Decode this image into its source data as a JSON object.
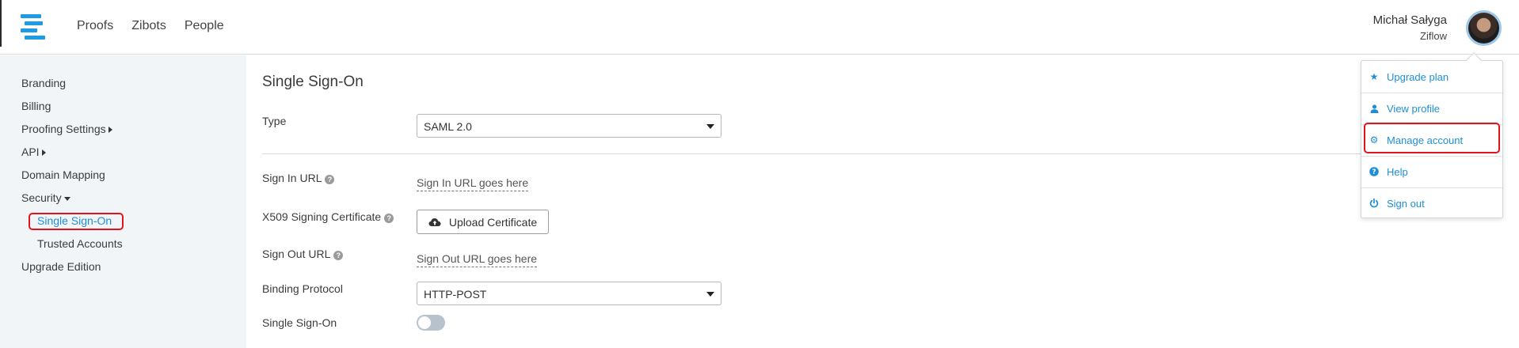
{
  "nav": {
    "items": [
      "Proofs",
      "Zibots",
      "People"
    ]
  },
  "user": {
    "name": "Michał Sałyga",
    "org": "Ziflow"
  },
  "sidebar": {
    "items": [
      {
        "label": "Branding"
      },
      {
        "label": "Billing"
      },
      {
        "label": "Proofing Settings"
      },
      {
        "label": "API"
      },
      {
        "label": "Domain Mapping"
      },
      {
        "label": "Security"
      },
      {
        "label": "Single Sign-On"
      },
      {
        "label": "Trusted Accounts"
      },
      {
        "label": "Upgrade Edition"
      }
    ]
  },
  "main": {
    "title": "Single Sign-On",
    "type_label": "Type",
    "type_value": "SAML 2.0",
    "sign_in_label": "Sign In URL",
    "sign_in_placeholder": "Sign In URL goes here",
    "cert_label": "X509 Signing Certificate",
    "upload_label": "Upload Certificate",
    "sign_out_label": "Sign Out URL",
    "sign_out_placeholder": "Sign Out URL goes here",
    "binding_label": "Binding Protocol",
    "binding_value": "HTTP-POST",
    "sso_toggle_label": "Single Sign-On",
    "sso_enabled": false
  },
  "menu": {
    "items": [
      {
        "label": "Upgrade plan",
        "icon": "star-icon"
      },
      {
        "label": "View profile",
        "icon": "user-icon"
      },
      {
        "label": "Manage account",
        "icon": "gear-icon"
      },
      {
        "label": "Help",
        "icon": "question-circle-icon"
      },
      {
        "label": "Sign out",
        "icon": "power-icon"
      }
    ]
  },
  "colors": {
    "accent": "#1e8fd6",
    "logo": "#1e9be6",
    "highlight": "#e0141e",
    "sidebar_bg": "#f2f5f8"
  }
}
